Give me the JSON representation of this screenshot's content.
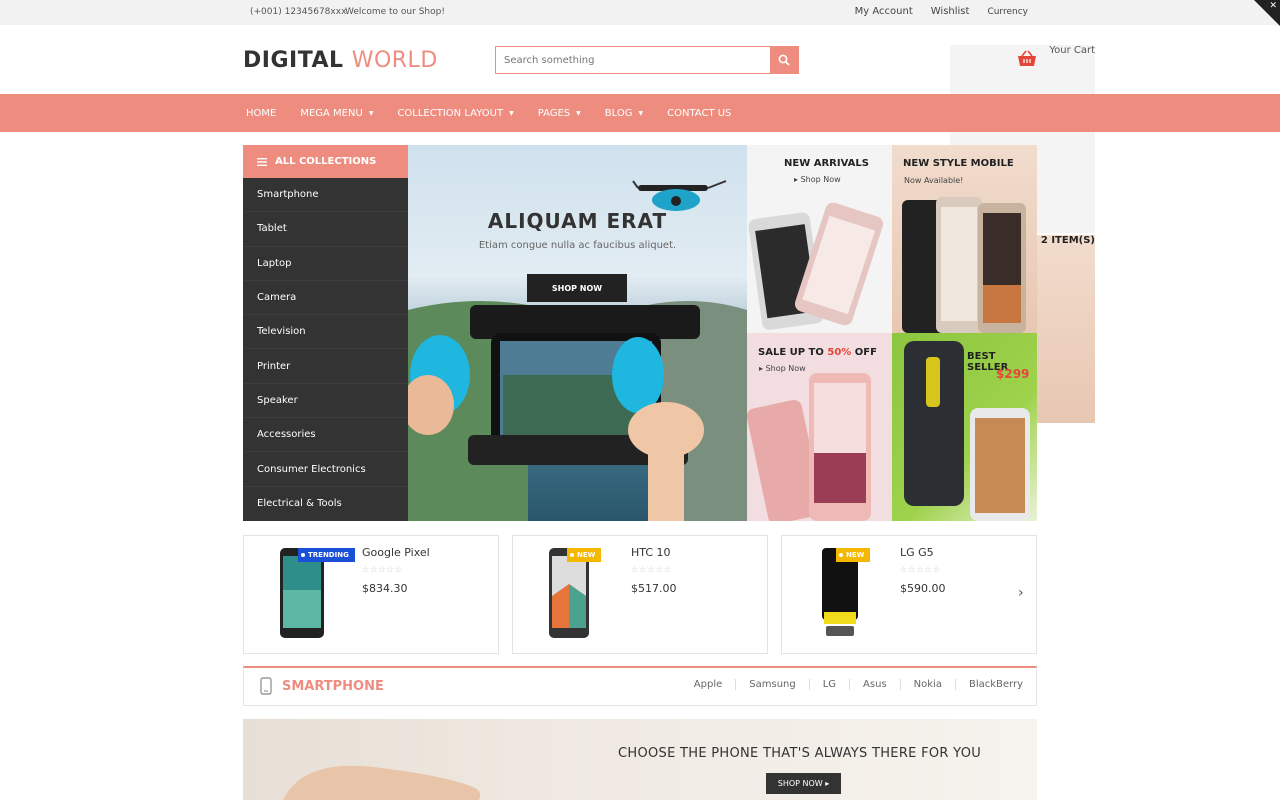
{
  "topbar": {
    "phone": "(+001) 12345678xxx",
    "welcome": "Welcome to our Shop!",
    "my_account": "My Account",
    "wishlist": "Wishlist",
    "currency": "Currency"
  },
  "header": {
    "logo_part1": "DIGITAL ",
    "logo_part2": "WORLD",
    "search_placeholder": "Search something",
    "cart_label": "Your Cart",
    "cart_count": "2 ITEM(S)"
  },
  "nav": [
    {
      "label": "HOME",
      "dropdown": false
    },
    {
      "label": "MEGA MENU",
      "dropdown": true
    },
    {
      "label": "COLLECTION LAYOUT",
      "dropdown": true
    },
    {
      "label": "PAGES",
      "dropdown": true
    },
    {
      "label": "BLOG",
      "dropdown": true
    },
    {
      "label": "CONTACT US",
      "dropdown": false
    }
  ],
  "collections": {
    "heading": "ALL COLLECTIONS",
    "items": [
      "Smartphone",
      "Tablet",
      "Laptop",
      "Camera",
      "Television",
      "Printer",
      "Speaker",
      "Accessories",
      "Consumer Electronics",
      "Electrical & Tools"
    ]
  },
  "hero": {
    "title": "ALIQUAM ERAT",
    "subtitle": "Etiam congue nulla ac faucibus aliquet.",
    "button": "SHOP NOW"
  },
  "tiles": {
    "new_arrivals": {
      "title": "NEW ARRIVALS",
      "link": "Shop Now"
    },
    "new_style": {
      "title": "NEW STYLE MOBILE",
      "sub": "Now Available!"
    },
    "sale": {
      "title_prefix": "SALE UP TO ",
      "percent": "50%",
      "title_suffix": " OFF",
      "link": "Shop Now"
    },
    "best_seller": {
      "title": "BEST SELLER",
      "price": "$299"
    }
  },
  "products": [
    {
      "name": "Google Pixel",
      "price": "$834.30",
      "badge": "TRENDING",
      "badge_color": "#1a4fd8"
    },
    {
      "name": "HTC 10",
      "price": "$517.00",
      "badge": "NEW",
      "badge_color": "#f5b800"
    },
    {
      "name": "LG G5",
      "price": "$590.00",
      "badge": "NEW",
      "badge_color": "#f5b800"
    }
  ],
  "stars": "☆☆☆☆☆",
  "category": {
    "title": "SMARTPHONE",
    "brands": [
      "Apple",
      "Samsung",
      "LG",
      "Asus",
      "Nokia",
      "BlackBerry"
    ]
  },
  "banner": {
    "title": "CHOOSE THE PHONE THAT'S ALWAYS THERE FOR YOU",
    "button": "SHOP NOW ▸"
  },
  "colors": {
    "accent": "#ee8d7f",
    "dark": "#333333"
  }
}
